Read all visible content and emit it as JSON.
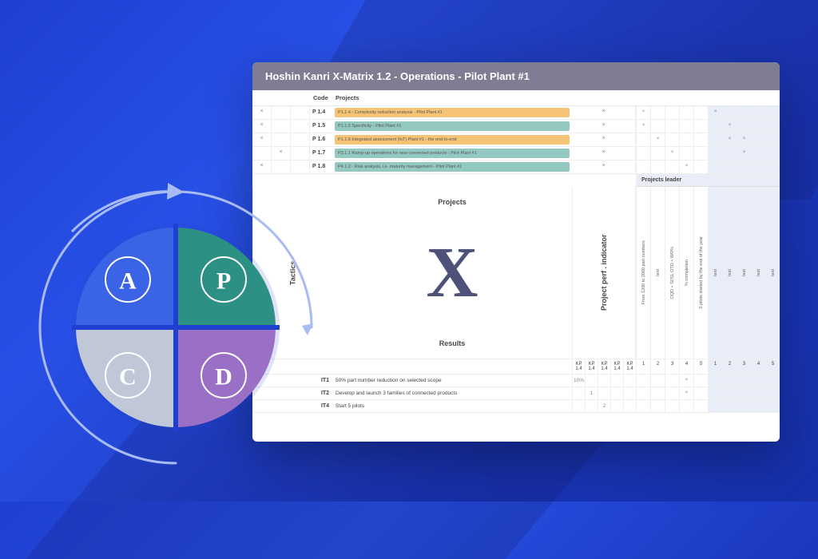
{
  "window": {
    "title": "Hoshin Kanri X-Matrix 1.2 - Operations - Pilot Plant #1",
    "columns": {
      "code": "Code",
      "projects": "Projects"
    },
    "rows": [
      {
        "code": "P 1.4",
        "label": "P1.1.4 - Complexity reduction analysis - Pilot Plant #1",
        "color": "orange",
        "leftX": [
          0
        ],
        "rightX": [
          0,
          5
        ]
      },
      {
        "code": "P 1.5",
        "label": "P1.1.5 Specificity - Pilot Plant #1",
        "color": "teal",
        "leftX": [
          0
        ],
        "rightX": [
          0,
          6
        ]
      },
      {
        "code": "P 1.6",
        "label": "P1.1.6 Integrated assessment (IoT) Plant #1 - the end-to-end",
        "color": "orange",
        "leftX": [
          0
        ],
        "rightX": [
          1,
          6,
          7
        ]
      },
      {
        "code": "P 1.7",
        "label": "P3.1.1 Ramp-up operations for new connected products - Pilot Plant #1",
        "color": "teal",
        "leftX": [
          1
        ],
        "rightX": [
          2,
          7
        ]
      },
      {
        "code": "P 1.8",
        "label": "P4.1.2 - Risk analysis, i.e. maturity management - Pilot Plant #1",
        "color": "teal",
        "leftX": [
          0
        ],
        "rightX": [
          3
        ]
      }
    ],
    "tacticsLabel": "Tactics",
    "center": {
      "top": "Projects",
      "bottom": "Results"
    },
    "ppiLabel": "Project perf . indicator",
    "plHeader": "Projects leader",
    "indicators": [
      "From 1200 to 2000 part numbers",
      "test",
      "OQD + SI/SL OTD + WR%",
      "% completion",
      "5 pilots started by the end of the year",
      "test",
      "test",
      "test",
      "test",
      "test"
    ],
    "kpiCodes": [
      "KP 1.4",
      "KP 1.4",
      "KP 1.4",
      "KP 1.4",
      "KP 1.4"
    ],
    "kpiNums": [
      "1",
      "2",
      "3",
      "4",
      "5"
    ],
    "results": [
      {
        "code": "IT1",
        "text": "50% part number reduction on selected scope",
        "kpi": [
          "10%",
          "",
          "",
          "",
          ""
        ],
        "x": [
          3
        ]
      },
      {
        "code": "IT2",
        "text": "Develop and launch 3 families of connected products",
        "kpi": [
          "",
          "1",
          "",
          "",
          ""
        ],
        "x": [
          3
        ]
      },
      {
        "code": "IT4",
        "text": "Start 5 pilots",
        "kpi": [
          "",
          "",
          "2",
          "",
          ""
        ],
        "x": []
      }
    ]
  },
  "pdca": {
    "quads": [
      {
        "letter": "A",
        "color": "#3b63e6"
      },
      {
        "letter": "P",
        "color": "#2d9085"
      },
      {
        "letter": "C",
        "color": "#c0c8d8"
      },
      {
        "letter": "D",
        "color": "#9a6fc6"
      }
    ]
  }
}
